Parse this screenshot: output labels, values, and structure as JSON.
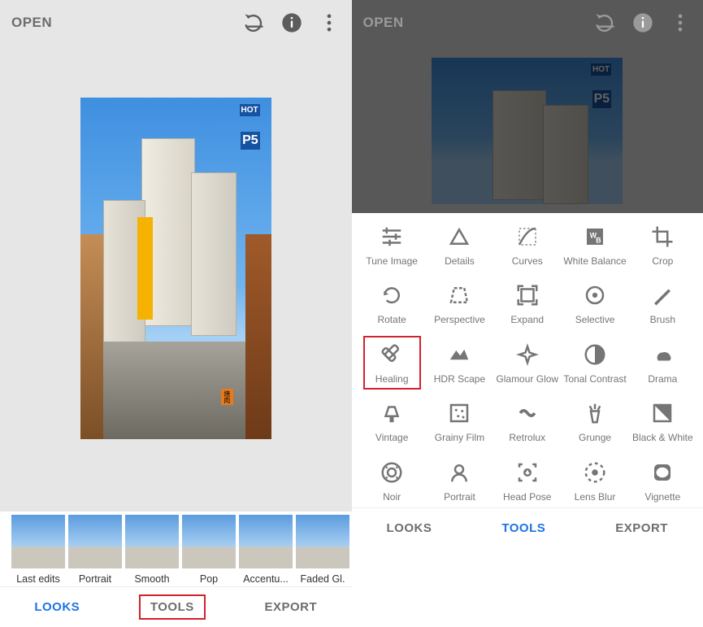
{
  "header": {
    "open": "OPEN"
  },
  "left": {
    "filmstrip": [
      {
        "label": "Last edits"
      },
      {
        "label": "Portrait"
      },
      {
        "label": "Smooth"
      },
      {
        "label": "Pop"
      },
      {
        "label": "Accentu..."
      },
      {
        "label": "Faded Gl."
      }
    ],
    "tabs": {
      "looks": "LOOKS",
      "tools": "TOOLS",
      "export": "EXPORT"
    },
    "active_tab": "looks",
    "highlighted_tab": "tools"
  },
  "right": {
    "tools": [
      {
        "label": "Tune Image",
        "icon": "sliders-icon"
      },
      {
        "label": "Details",
        "icon": "triangle-icon"
      },
      {
        "label": "Curves",
        "icon": "curves-icon"
      },
      {
        "label": "White Balance",
        "icon": "wb-icon"
      },
      {
        "label": "Crop",
        "icon": "crop-icon"
      },
      {
        "label": "Rotate",
        "icon": "rotate-icon"
      },
      {
        "label": "Perspective",
        "icon": "perspective-icon"
      },
      {
        "label": "Expand",
        "icon": "expand-icon"
      },
      {
        "label": "Selective",
        "icon": "selective-icon"
      },
      {
        "label": "Brush",
        "icon": "brush-icon"
      },
      {
        "label": "Healing",
        "icon": "healing-icon",
        "highlight": true
      },
      {
        "label": "HDR Scape",
        "icon": "hdr-icon"
      },
      {
        "label": "Glamour Glow",
        "icon": "glamour-icon"
      },
      {
        "label": "Tonal Contrast",
        "icon": "tonal-icon"
      },
      {
        "label": "Drama",
        "icon": "drama-icon"
      },
      {
        "label": "Vintage",
        "icon": "vintage-icon"
      },
      {
        "label": "Grainy Film",
        "icon": "grainy-icon"
      },
      {
        "label": "Retrolux",
        "icon": "retrolux-icon"
      },
      {
        "label": "Grunge",
        "icon": "grunge-icon"
      },
      {
        "label": "Black & White",
        "icon": "bw-icon"
      },
      {
        "label": "Noir",
        "icon": "noir-icon"
      },
      {
        "label": "Portrait",
        "icon": "portrait-icon"
      },
      {
        "label": "Head Pose",
        "icon": "headpose-icon"
      },
      {
        "label": "Lens Blur",
        "icon": "lensblur-icon"
      },
      {
        "label": "Vignette",
        "icon": "vignette-icon"
      }
    ],
    "tabs": {
      "looks": "LOOKS",
      "tools": "TOOLS",
      "export": "EXPORT"
    },
    "active_tab": "tools"
  },
  "photo_signs": {
    "hot": "HOT",
    "p5": "P5"
  }
}
